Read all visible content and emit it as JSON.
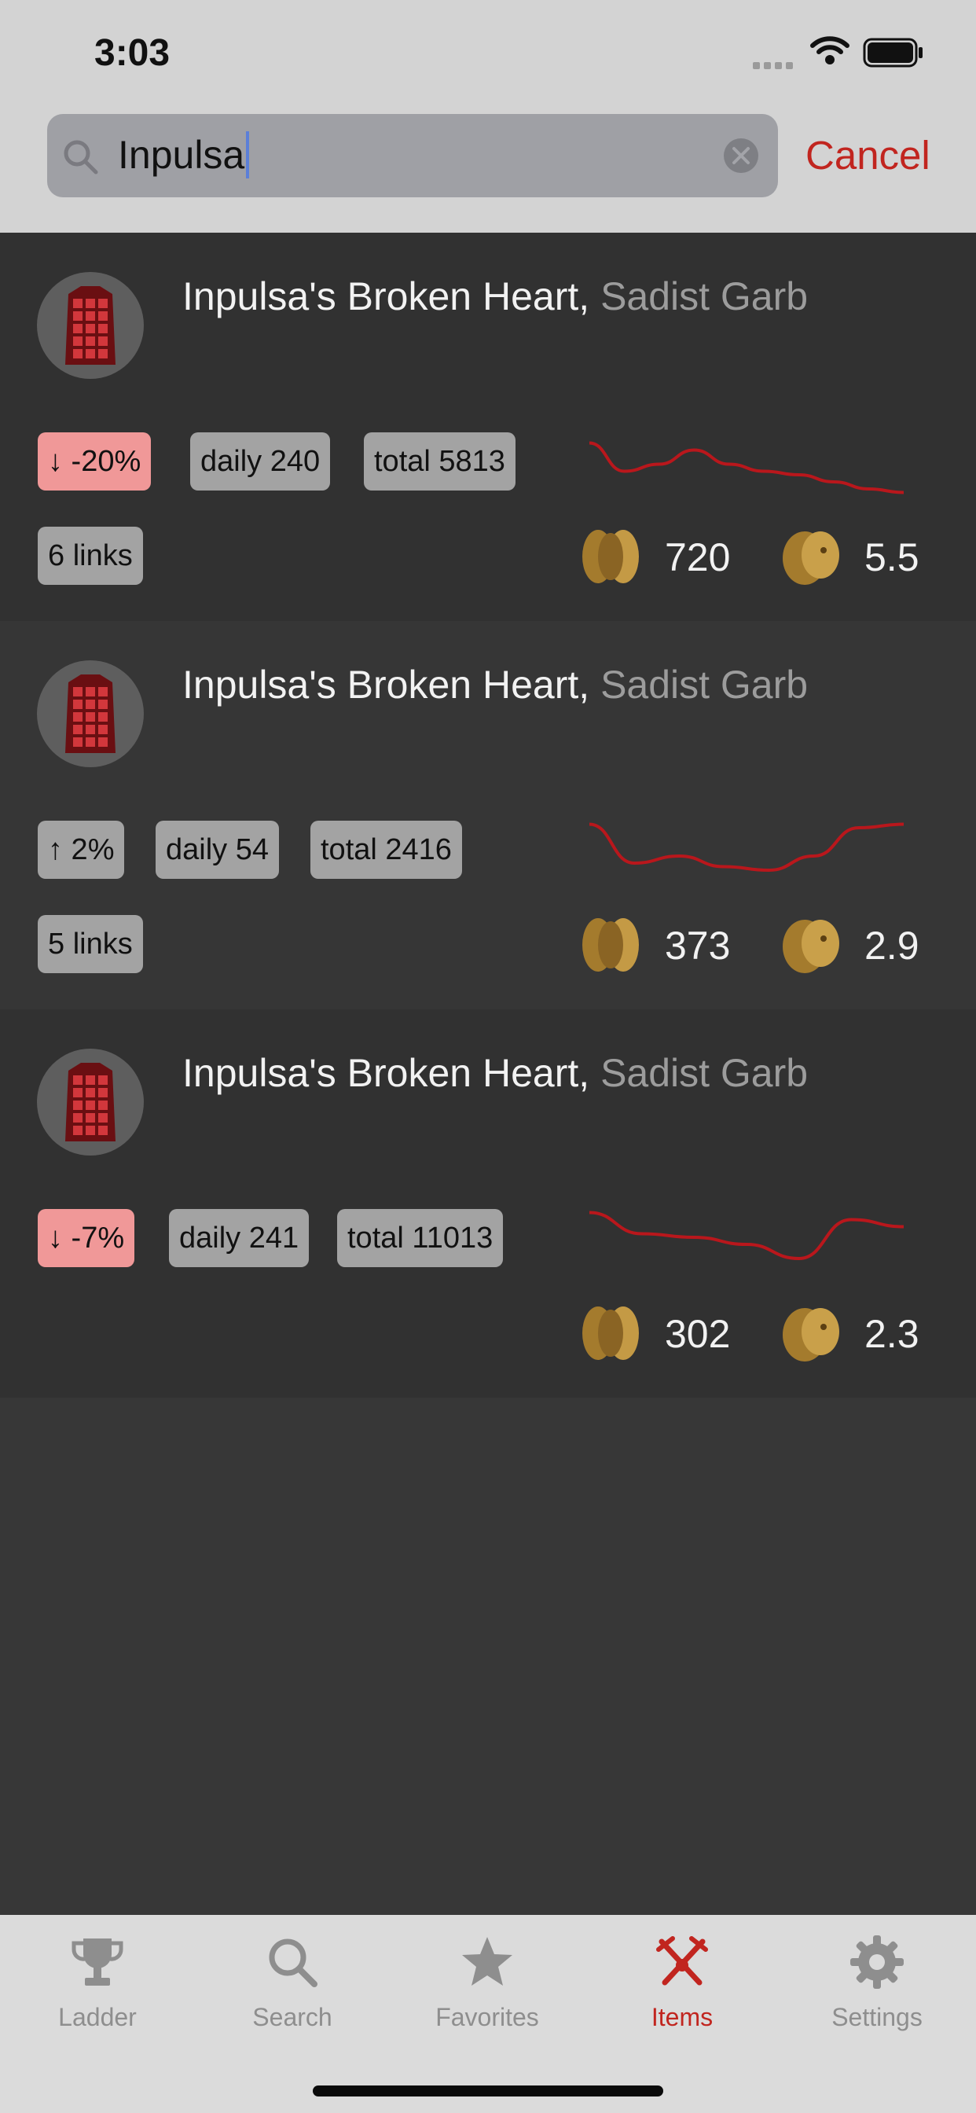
{
  "status_bar": {
    "time": "3:03"
  },
  "search": {
    "query": "Inpulsa",
    "cancel_label": "Cancel"
  },
  "colors": {
    "accent": "#c1251f",
    "trend_line": "#b9171c",
    "down_chip": "#f09898",
    "chip": "#a3a3a3"
  },
  "items": [
    {
      "name": "Inpulsa's Broken Heart",
      "separator": ",",
      "base": "Sadist Garb",
      "change": "↓ -20%",
      "trend": "down",
      "daily": "daily 240",
      "total": "total 5813",
      "links": "6 links",
      "price_divine": "720",
      "price_chaos": "5.5",
      "sparkline": [
        0.85,
        0.45,
        0.55,
        0.75,
        0.55,
        0.45,
        0.4,
        0.3,
        0.2,
        0.15
      ]
    },
    {
      "name": "Inpulsa's Broken Heart",
      "separator": ",",
      "base": "Sadist Garb",
      "change": "↑ 2%",
      "trend": "up",
      "daily": "daily 54",
      "total": "total 2416",
      "links": "5 links",
      "price_divine": "373",
      "price_chaos": "2.9",
      "sparkline": [
        0.95,
        0.4,
        0.5,
        0.35,
        0.3,
        0.5,
        0.9,
        0.95
      ]
    },
    {
      "name": "Inpulsa's Broken Heart",
      "separator": ",",
      "base": "Sadist Garb",
      "change": "↓ -7%",
      "trend": "down",
      "daily": "daily 241",
      "total": "total 11013",
      "links": "",
      "price_divine": "302",
      "price_chaos": "2.3",
      "sparkline": [
        0.95,
        0.65,
        0.6,
        0.5,
        0.3,
        0.85,
        0.75
      ]
    }
  ],
  "tabbar": {
    "tabs": [
      {
        "label": "Ladder",
        "icon": "trophy-icon",
        "active": false
      },
      {
        "label": "Search",
        "icon": "search-icon",
        "active": false
      },
      {
        "label": "Favorites",
        "icon": "star-icon",
        "active": false
      },
      {
        "label": "Items",
        "icon": "crossed-swords-icon",
        "active": true
      },
      {
        "label": "Settings",
        "icon": "gear-icon",
        "active": false
      }
    ]
  }
}
